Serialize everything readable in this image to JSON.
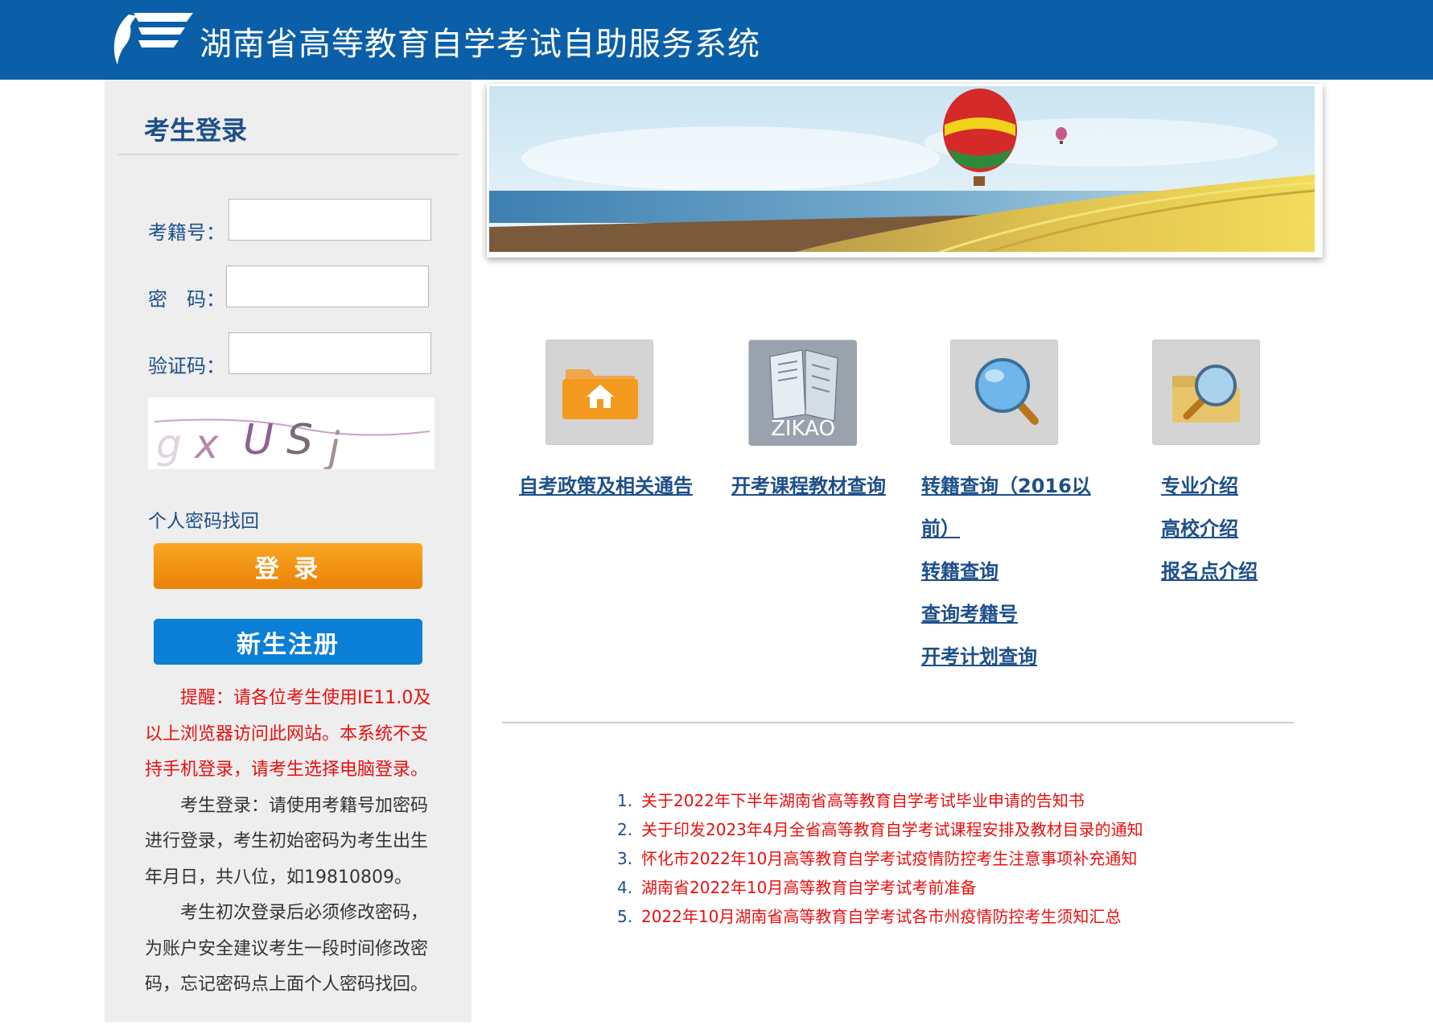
{
  "header": {
    "title": "湖南省高等教育自学考试自助服务系统",
    "brand_color": "#0a5fa8"
  },
  "login": {
    "title": "考生登录",
    "exam_id_label": "考籍号：",
    "exam_id_value": "",
    "password_label": "密　码：",
    "password_value": "",
    "captcha_label": "验证码：",
    "captcha_value": "",
    "captcha_image_text": "gxUSj",
    "forgot_password": "个人密码找回",
    "login_button": "登 录",
    "register_button": "新生注册"
  },
  "notes": {
    "reminder": "提醒：请各位考生使用IE11.0及以上浏览器访问此网站。本系统不支持手机登录，请考生选择电脑登录。",
    "login_tip": "考生登录：请使用考籍号加密码进行登录，考生初始密码为考生出生年月日，共八位，如19810809。",
    "first_login_tip": "考生初次登录后必须修改密码，为账户安全建议考生一段时间修改密码，忘记密码点上面个人密码找回。"
  },
  "tiles": [
    {
      "icon": "home-folder-icon",
      "links": [
        "自考政策及相关通告"
      ]
    },
    {
      "icon": "zikao-book-icon",
      "icon_text": "ZIKAO",
      "links": [
        "开考课程教材查询"
      ]
    },
    {
      "icon": "magnifier-icon",
      "links": [
        "转籍查询（2016以",
        "前）",
        "转籍查询",
        "查询考籍号",
        "开考计划查询"
      ]
    },
    {
      "icon": "folder-search-icon",
      "links": [
        "专业介绍",
        "高校介绍",
        "报名点介绍"
      ]
    }
  ],
  "notices": [
    {
      "num": "1.",
      "text": "关于2022年下半年湖南省高等教育自学考试毕业申请的告知书"
    },
    {
      "num": "2.",
      "text": "关于印发2023年4月全省高等教育自学考试课程安排及教材目录的通知"
    },
    {
      "num": "3.",
      "text": "怀化市2022年10月高等教育自学考试疫情防控考生注意事项补充通知"
    },
    {
      "num": "4.",
      "text": "湖南省2022年10月高等教育自学考试考前准备"
    },
    {
      "num": "5.",
      "text": "2022年10月湖南省高等教育自学考试各市州疫情防控考生须知汇总"
    }
  ],
  "colors": {
    "link_blue": "#1d4f8a",
    "notice_red": "#e81010",
    "login_orange": "#f39214",
    "register_blue": "#0b7fd6"
  }
}
